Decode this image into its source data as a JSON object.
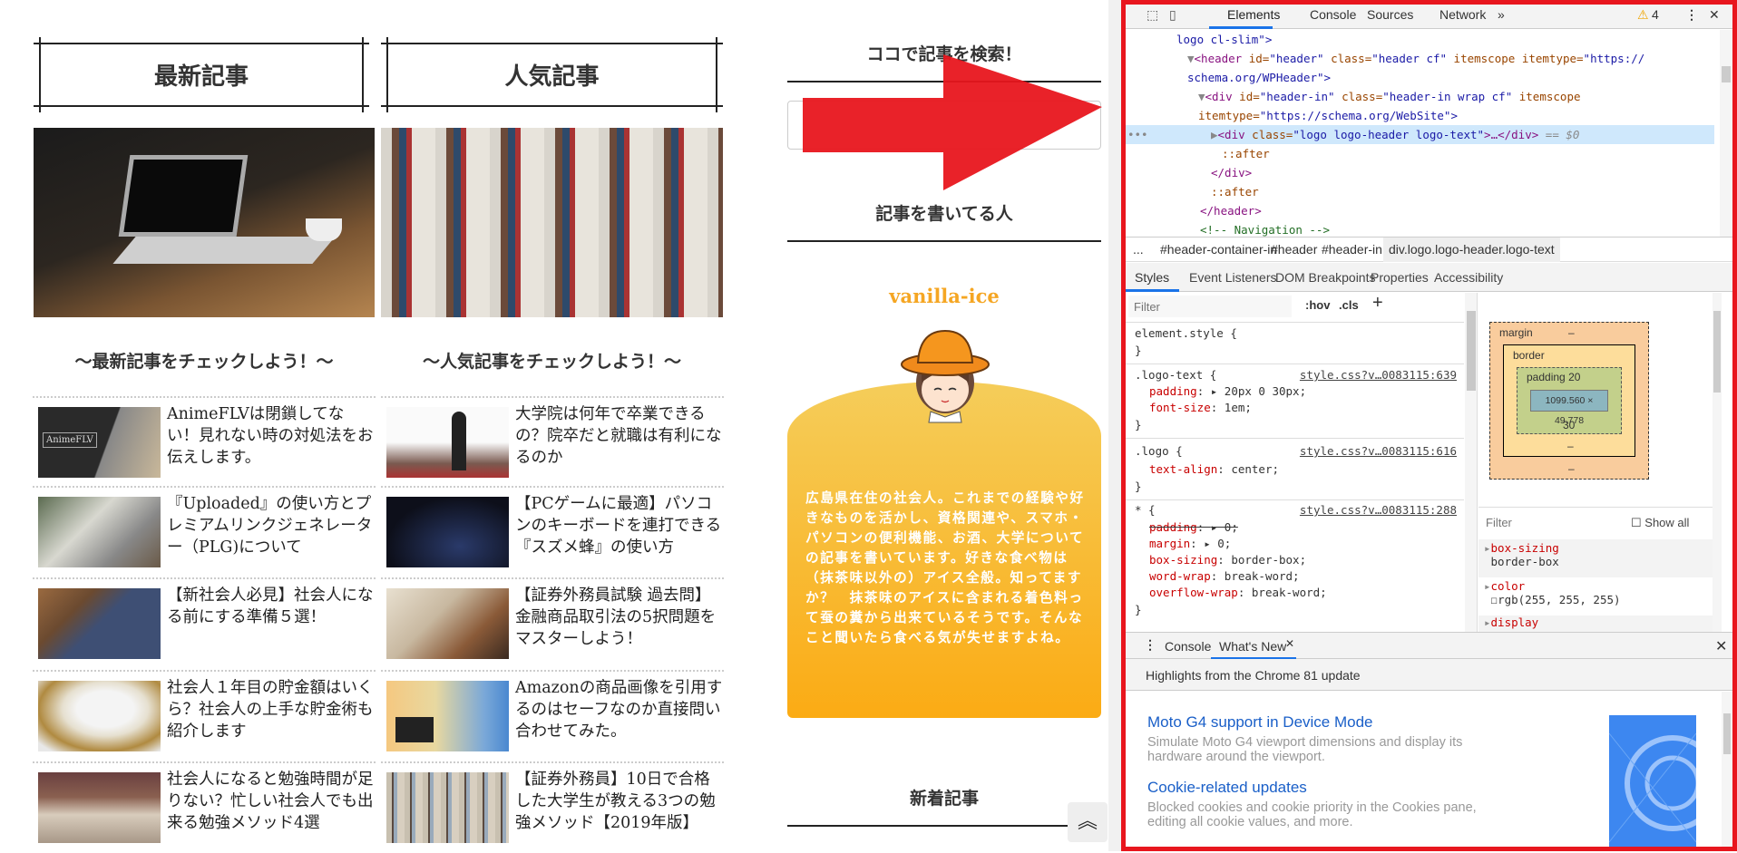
{
  "main": {
    "latest_heading": "最新記事",
    "popular_heading": "人気記事",
    "latest_sub": "〜最新記事をチェックしよう！〜",
    "popular_sub": "〜人気記事をチェックしよう！〜",
    "latest_articles": [
      {
        "title": "AnimeFLVは閉鎖してない！見れない時の対処法をお伝えします。",
        "thumb_label": "AnimeFLV"
      },
      {
        "title": "『Uploaded』の使い方とプレミアムリンクジェネレーター（PLG)について"
      },
      {
        "title": "【新社会人必見】社会人になる前にする準備５選！"
      },
      {
        "title": "社会人１年目の貯金額はいくら？社会人の上手な貯金術も紹介します"
      },
      {
        "title": "社会人になると勉強時間が足りない？忙しい社会人でも出来る勉強メソッド4選"
      }
    ],
    "popular_articles": [
      {
        "title": "大学院は何年で卒業できるの？院卒だと就職は有利になるのか"
      },
      {
        "title": "【PCゲームに最適】パソコンのキーボードを連打できる『スズメ蜂』の使い方"
      },
      {
        "title": "【証券外務員試験 過去問】金融商品取引法の5択問題をマスターしよう！"
      },
      {
        "title": "Amazonの商品画像を引用するのはセーフなのか直接問い合わせてみた。"
      },
      {
        "title": "【証券外務員】10日で合格した大学生が教える3つの勉強メソッド【2019年版】"
      }
    ]
  },
  "sidebar": {
    "search_heading": "ココで記事を検索！",
    "author_heading": "記事を書いてる人",
    "author_name": "vanilla-ice",
    "author_bio": "広島県在住の社会人。これまでの経験や好きなものを活かし、資格関連や、スマホ・パソコンの便利機能、お酒、大学についての記事を書いています。好きな食べ物は（抹茶味以外の）アイス全般。知ってますか？　抹茶味のアイスに含まれる着色料って蚕の糞から出来ているそうです。そんなこと聞いたら食べる気が失せますよね。",
    "new_heading": "新着記事",
    "accent_color": "#f5a623",
    "scroll_top_icon": "double-chevron-up-icon"
  },
  "devtools": {
    "tabs": [
      "Elements",
      "Console",
      "Sources",
      "Network",
      "»"
    ],
    "active_tab": "Elements",
    "warning_count": "4",
    "dom": {
      "l0": "logo cl-slim\">",
      "l1a": "<header",
      "l1b": " id=",
      "l1c": "\"header\"",
      "l1d": " class=",
      "l1e": "\"header cf\"",
      "l1f": " itemscope itemtype=",
      "l1g": "\"https://",
      "l2": "schema.org/WPHeader\">",
      "l3a": "<div",
      "l3b": " id=",
      "l3c": "\"header-in\"",
      "l3d": " class=",
      "l3e": "\"header-in wrap cf\"",
      "l3f": " itemscope",
      "l4a": "itemtype=",
      "l4b": "\"https://schema.org/WebSite\">",
      "l5a": "<div",
      "l5b": " class=",
      "l5c": "\"logo logo-header logo-text\"",
      "l5d": ">…</div>",
      "l5e": " == $0",
      "l6": "::after",
      "l7": "</div>",
      "l8": "::after",
      "l9": "</header>",
      "l10": "<!-- Navigation -->"
    },
    "breadcrumbs": [
      "...",
      "#header-container-in",
      "#header",
      "#header-in",
      "div.logo.logo-header.logo-text"
    ],
    "sub_tabs": [
      "Styles",
      "Event Listeners",
      "DOM Breakpoints",
      "Properties",
      "Accessibility"
    ],
    "filter_placeholder": "Filter",
    "hov": ":hov",
    "cls": ".cls",
    "plus": "+",
    "rules": [
      {
        "selector": "element.style {",
        "source": "",
        "props": []
      },
      {
        "selector": ".logo-text {",
        "source": "style.css?v…0083115:639",
        "props": [
          {
            "name": "padding",
            "value": "▸ 20px 0 30px;"
          },
          {
            "name": "font-size",
            "value": " 1em;"
          }
        ]
      },
      {
        "selector": ".logo {",
        "source": "style.css?v…0083115:616",
        "props": [
          {
            "name": "text-align",
            "value": " center;"
          }
        ]
      },
      {
        "selector": "* {",
        "source": "style.css?v…0083115:288",
        "props": [
          {
            "name": "padding",
            "value": "▸ 0;"
          },
          {
            "name": "margin",
            "value": "▸ 0;"
          },
          {
            "name": "box-sizing",
            "value": " border-box;"
          },
          {
            "name": "word-wrap",
            "value": " break-word;"
          },
          {
            "name": "overflow-wrap",
            "value": " break-word;"
          }
        ]
      }
    ],
    "box_model": {
      "margin_label": "margin",
      "border_label": "border",
      "padding_label": "padding",
      "dash": "–",
      "padding_top": "20",
      "padding_bottom": "30",
      "content": "1099.560 × 49.778",
      "padding_side": "-"
    },
    "computed": {
      "filter": "Filter",
      "show_all": "Show all",
      "items": [
        {
          "name": "box-sizing",
          "value": "border-box"
        },
        {
          "name": "color",
          "value": "rgb(255, 255, 255)"
        },
        {
          "name": "display",
          "value": ""
        }
      ]
    },
    "drawer": {
      "tabs": [
        "Console",
        "What's New"
      ],
      "active": "What's New",
      "highlight": "Highlights from the Chrome 81 update",
      "items": [
        {
          "title": "Moto G4 support in Device Mode",
          "desc1": "Simulate Moto G4 viewport dimensions and display its",
          "desc2": "hardware around the viewport."
        },
        {
          "title": "Cookie-related updates",
          "desc1": "Blocked cookies and cookie priority in the Cookies pane,",
          "desc2": "editing all cookie values, and more."
        }
      ]
    }
  }
}
